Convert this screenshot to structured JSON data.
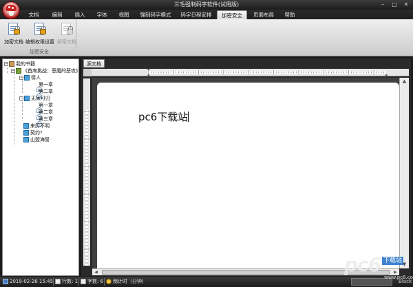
{
  "window": {
    "title": "三毛强制码字软件(试用版)",
    "controls": [
      "–",
      "□",
      "✕"
    ]
  },
  "ribbon": {
    "tabs": [
      "文档",
      "编辑",
      "插入",
      "字体",
      "视图",
      "强制码字模式",
      "码字日程安排",
      "加密安全",
      "页面布局",
      "帮助"
    ],
    "active_tab": "加密安全",
    "group_label": "加密安全",
    "buttons": [
      {
        "label": "加密文档",
        "icon": "encrypt-doc-icon",
        "enabled": true
      },
      {
        "label": "编辑权限设置",
        "icon": "edit-permission-icon",
        "enabled": true
      },
      {
        "label": "解密文档",
        "icon": "decrypt-doc-icon",
        "enabled": false
      }
    ]
  },
  "tree": {
    "root": "我的书籍",
    "book": "《首席挑战：恶魔的恶攻》",
    "nodes": [
      {
        "label": "情人"
      },
      {
        "label": "第一章"
      },
      {
        "label": "第二章"
      },
      {
        "label": "无家可归"
      },
      {
        "label": "第一章"
      },
      {
        "label": "第二章"
      },
      {
        "label": "第三章"
      },
      {
        "label": "来历不明"
      },
      {
        "label": "契约?"
      },
      {
        "label": "山盟海誓"
      }
    ]
  },
  "editor": {
    "doc_tab": "源文档",
    "content": "pc6下载站"
  },
  "status": {
    "date": "2019-02-26 15:45",
    "lines": "行数: 1",
    "chars": "字数: 6",
    "timer": "倒计时（分钟）",
    "mode": "Black"
  },
  "watermark": {
    "letters": "pc6",
    "box": "下载站",
    "url": "www.pc6.com"
  },
  "colors": {
    "title_bar": "#1c1c1c",
    "ribbon_bg": "#e0e0e0",
    "canvas_bg": "#404040",
    "page_bg": "#ffffff"
  }
}
